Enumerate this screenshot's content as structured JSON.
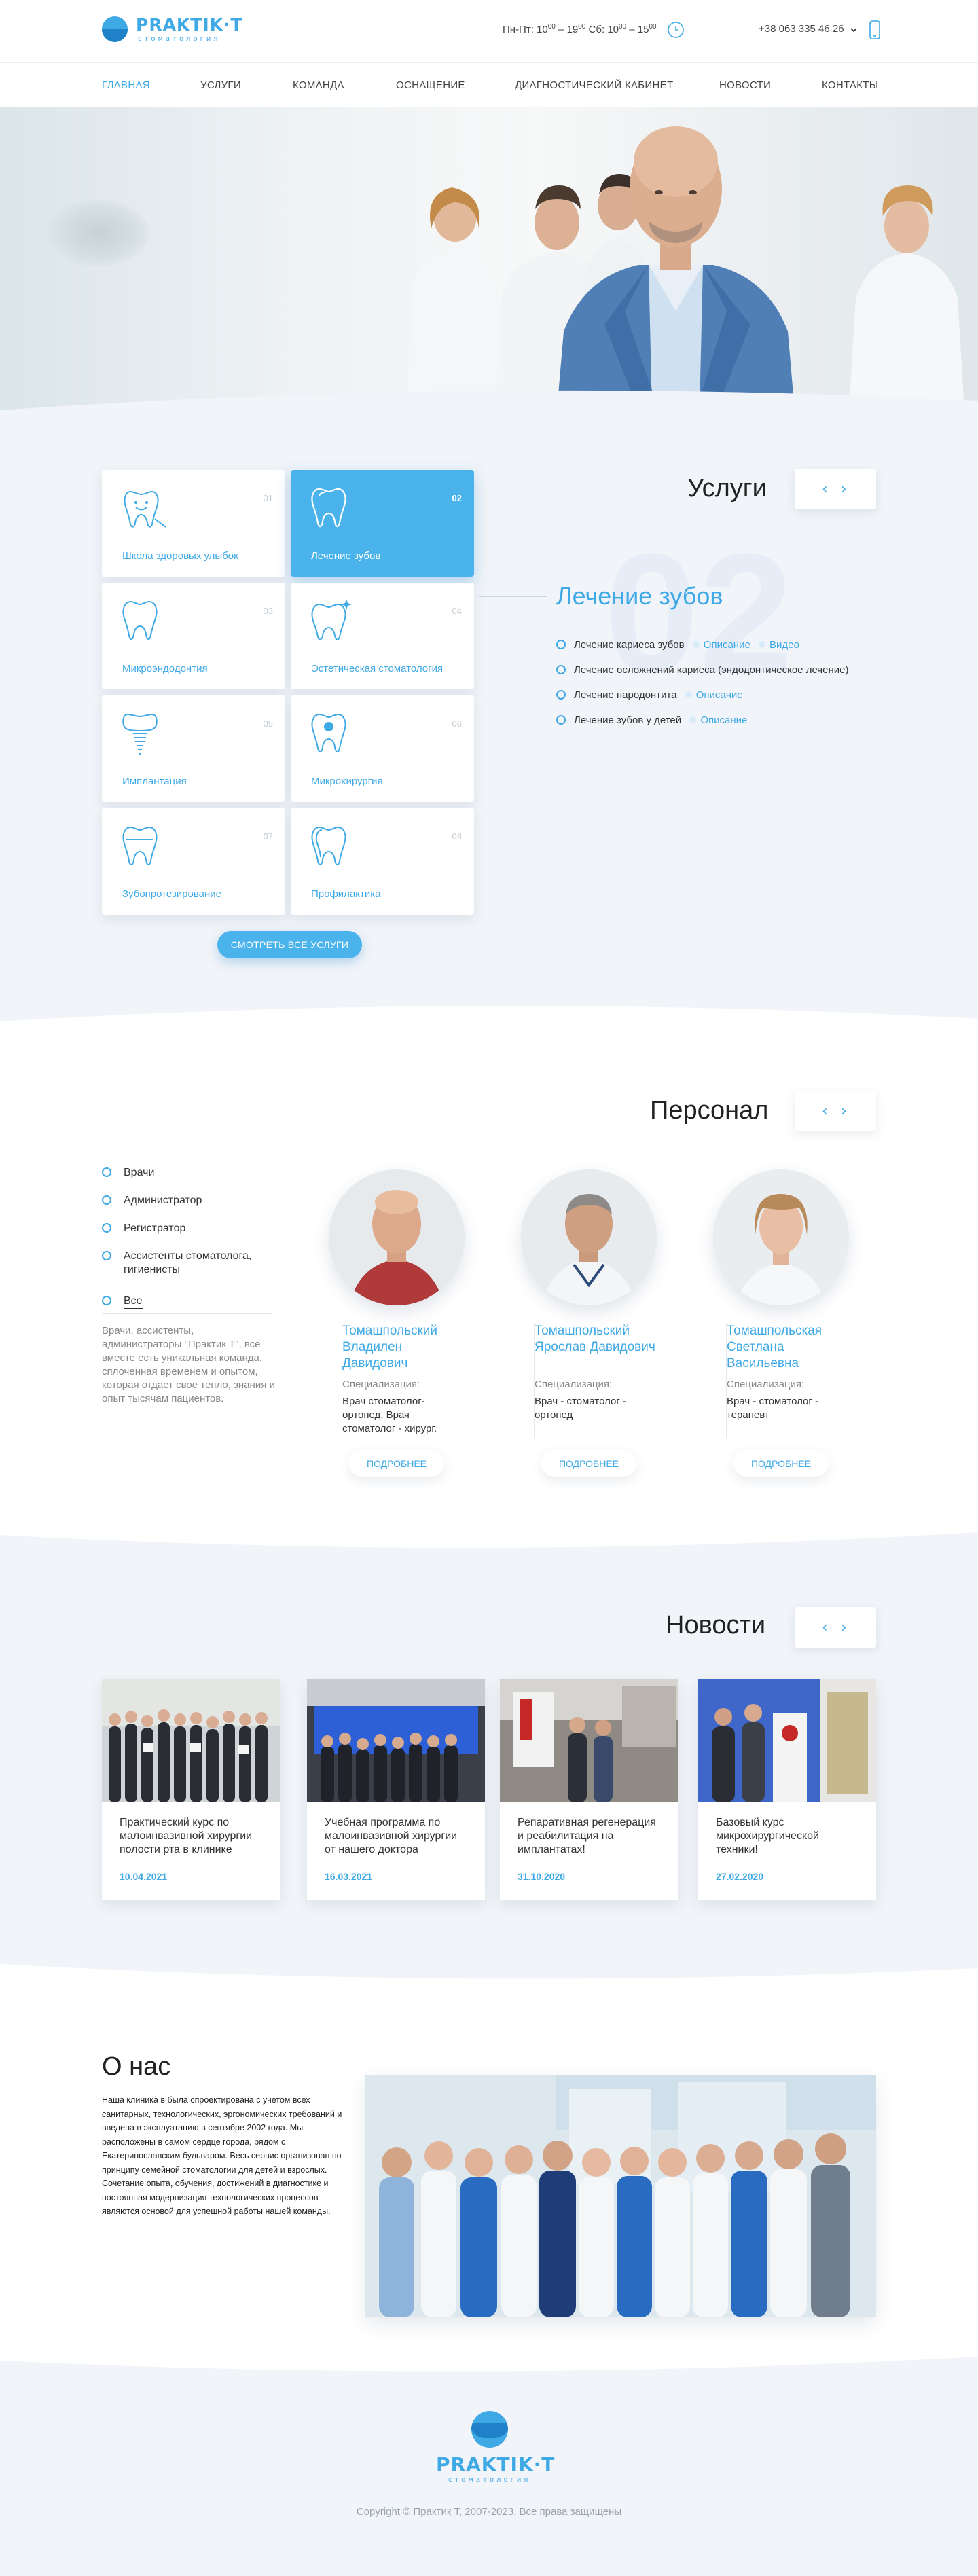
{
  "brand": {
    "name": "PRAKTIK·T",
    "tagline": "стоматология",
    "accent_color": "#3fa9e6"
  },
  "header": {
    "hours": {
      "weekdays": "Пн-Пт:",
      "weekdays_open_h": "10",
      "weekdays_open_m": "00",
      "weekdays_close_h": "19",
      "weekdays_close_m": "00",
      "saturday": "Сб:",
      "sat_open_h": "10",
      "sat_open_m": "00",
      "sat_close_h": "15",
      "sat_close_m": "00",
      "dash": "–",
      "icon": "clock-icon"
    },
    "phone": "+38 063 335 46 26",
    "phone_icon": "mobile-phone-icon"
  },
  "nav": {
    "items": [
      {
        "label": "ГЛАВНАЯ",
        "active": true
      },
      {
        "label": "УСЛУГИ"
      },
      {
        "label": "КОМАНДА"
      },
      {
        "label": "ОСНАЩЕНИЕ"
      },
      {
        "label": "ДИАГНОСТИЧЕСКИЙ КАБИНЕТ"
      },
      {
        "label": "НОВОСТИ"
      },
      {
        "label": "КОНТАКТЫ"
      }
    ]
  },
  "services": {
    "title": "Услуги",
    "prev": "‹",
    "next": "›",
    "cards": [
      {
        "num": "01",
        "label": "Школа здоровых улыбок",
        "icon": "happy-tooth-icon"
      },
      {
        "num": "02",
        "label": "Лечение зубов",
        "icon": "tooth-icon",
        "active": true
      },
      {
        "num": "03",
        "label": "Микроэндодонтия",
        "icon": "tooth-icon"
      },
      {
        "num": "04",
        "label": "Эстетическая стоматология",
        "icon": "sparkle-tooth-icon"
      },
      {
        "num": "05",
        "label": "Имплантация",
        "icon": "implant-icon"
      },
      {
        "num": "06",
        "label": "Микрохирургия",
        "icon": "tooth-target-icon"
      },
      {
        "num": "07",
        "label": "Зубопротезирование",
        "icon": "tooth-crown-icon"
      },
      {
        "num": "08",
        "label": "Профилактика",
        "icon": "tooth-icon"
      }
    ],
    "selected": {
      "number": "02",
      "heading": "Лечение зубов",
      "procedures": [
        {
          "label": "Лечение кариеса зубов",
          "links": [
            "Описание",
            "Видео"
          ]
        },
        {
          "label": "Лечение осложнений кариеса (эндодонтическое лечение)",
          "links": []
        },
        {
          "label": "Лечение пародонтита",
          "links": [
            "Описание"
          ]
        },
        {
          "label": "Лечение зубов у детей",
          "links": [
            "Описание"
          ]
        }
      ]
    },
    "all_button": "СМОТРЕТЬ ВСЕ УСЛУГИ"
  },
  "staff": {
    "title": "Персонал",
    "prev": "‹",
    "next": "›",
    "filters": [
      {
        "label": "Врачи"
      },
      {
        "label": "Администратор"
      },
      {
        "label": "Регистратор"
      },
      {
        "label": "Ассистенты стоматолога, гигиенисты"
      },
      {
        "label": "Все",
        "active": true
      }
    ],
    "description": "Врачи, ассистенты, администраторы \"Практик Т\", все вместе есть уникальная команда, сплоченная временем и опытом, которая отдает свое тепло, знания и опыт тысячам пациентов.",
    "spec_label": "Специализация:",
    "more_label": "ПОДРОБНЕЕ",
    "doctors": [
      {
        "name": "Томашпольский Владилен Давидович",
        "spec": "Врач стоматолог-ортопед. Врач стоматолог - хирург."
      },
      {
        "name": "Томашпольский Ярослав Давидович",
        "spec": "Врач - стоматолог - ортопед"
      },
      {
        "name": "Томашпольская Светлана Васильевна",
        "spec": "Врач - стоматолог - терапевт"
      }
    ]
  },
  "news": {
    "title": "Новости",
    "prev": "‹",
    "next": "›",
    "items": [
      {
        "title": "Практический курс по малоинвазивной хирургии полости рта в клинике",
        "date": "10.04.2021"
      },
      {
        "title": "Учебная программа по малоинвазивной хирургии от нашего доктора",
        "date": "16.03.2021"
      },
      {
        "title": "Репаративная регенерация и реабилитация на имплантатах!",
        "date": "31.10.2020"
      },
      {
        "title": "Базовый курс микрохирургической техники!",
        "date": "27.02.2020"
      }
    ]
  },
  "about": {
    "title": "О нас",
    "text": "Наша клиника в была спроектирована с учетом всех санитарных, технологических, эргономических требований и введена в эксплуатацию в сентябре 2002 года. Мы расположены в самом сердце города, рядом с Екатеринославским бульваром. Весь сервис организован по принципу семейной стоматологии для детей и взрослых. Сочетание опыта, обучения, достижений в диагностике и постоянная модернизация технологических процессов – являются основой для успешной работы нашей команды."
  },
  "footer": {
    "copyright": "Copyright © Практик Т, 2007-2023, Все права защищены"
  }
}
